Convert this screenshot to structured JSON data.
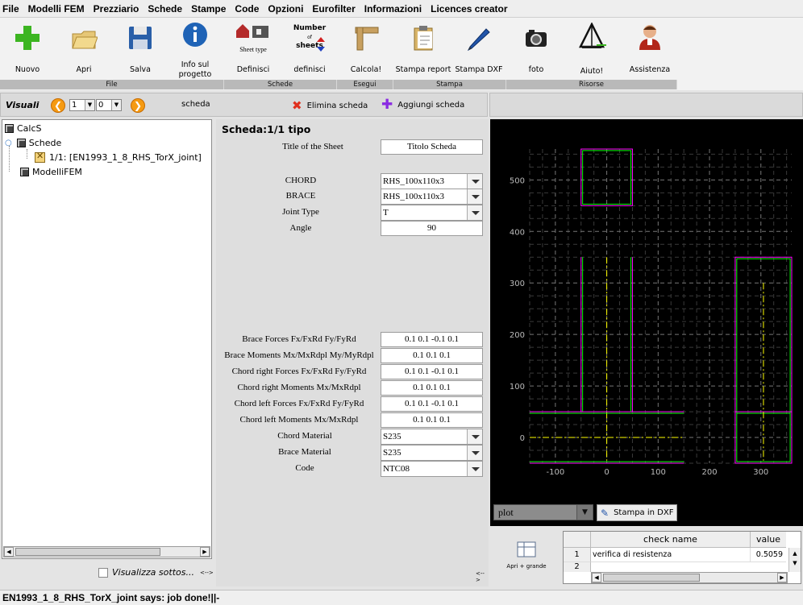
{
  "menu": [
    "File",
    "Modelli FEM",
    "Prezziario",
    "Schede",
    "Stampe",
    "Code",
    "Opzioni",
    "Eurofilter",
    "Informazioni",
    "Licences creator"
  ],
  "ribbon": {
    "tools": {
      "nuovo": "Nuovo",
      "apri": "Apri",
      "salva": "Salva",
      "info1": "Info sul",
      "info2": "progetto",
      "definisci": "Definisci",
      "sheet_type": "Sheet type",
      "number1": "Number",
      "number2": "of",
      "number3": "sheets",
      "definisci2": "definisci",
      "calcola": "Calcola!",
      "stampa_report": "Stampa report",
      "stampa_dxf": "Stampa DXF",
      "foto": "foto",
      "aiuto": "Aiuto!",
      "assistenza": "Assistenza"
    },
    "groups": {
      "file": "File",
      "schede": "Schede",
      "esegui": "Esegui",
      "stampa": "Stampa",
      "risorse": "Risorse"
    }
  },
  "visuali": {
    "title": "Visuali",
    "spin1": "1",
    "spin2": "0",
    "scheda": "scheda",
    "elimina": "Elimina scheda",
    "aggiungi": "Aggiungi scheda"
  },
  "tree": {
    "root": "CalcS",
    "schede": "Schede",
    "item": "1/1: [EN1993_1_8_RHS_TorX_joint]",
    "modelli": "ModelliFEM",
    "visualizza": "Visualizza sottos...",
    "arrows": "<-->"
  },
  "sheet": {
    "title": "Scheda:1/1 tipo",
    "title_label": "Title of the Sheet",
    "title_value": "Titolo Scheda",
    "chord_label": "CHORD",
    "chord_value": "RHS_100x110x3",
    "brace_label": "BRACE",
    "brace_value": "RHS_100x110x3",
    "joint_label": "Joint Type",
    "joint_value": "T",
    "angle_label": "Angle",
    "angle_value": "90",
    "bf_label": "Brace Forces Fx/FxRd Fy/FyRd",
    "bf_value": "0.1 0.1 -0.1 0.1",
    "bm_label": "Brace Moments Mx/MxRdpl My/MyRdpl",
    "bm_value": "0.1 0.1 0.1",
    "crf_label": "Chord right Forces Fx/FxRd Fy/FyRd",
    "crf_value": "0.1 0.1 -0.1 0.1",
    "crm_label": "Chord right Moments Mx/MxRdpl",
    "crm_value": "0.1 0.1 0.1",
    "clf_label": "Chord left Forces Fx/FxRd Fy/FyRd",
    "clf_value": "0.1 0.1 -0.1 0.1",
    "clm_label": "Chord left Moments Mx/MxRdpl",
    "clm_value": "0.1 0.1 0.1",
    "cmat_label": "Chord Material",
    "cmat_value": "S235",
    "bmat_label": "Brace Material",
    "bmat_value": "S235",
    "code_label": "Code",
    "code_value": "NTC08",
    "arrows": "<-->"
  },
  "plot": {
    "select": "plot",
    "stampa_dxf": "Stampa in DXF",
    "yticks": [
      "500",
      "400",
      "300",
      "200",
      "100",
      "0"
    ],
    "xticks": [
      "-100",
      "0",
      "100",
      "200",
      "300"
    ]
  },
  "results": {
    "apri_grande": "Apri + grande",
    "col_check": "check name",
    "col_value": "value",
    "row1_index": "1",
    "row1_name": "verifica di resistenza",
    "row1_value": "0.5059",
    "row2_index": "2"
  },
  "status": "EN1993_1_8_RHS_TorX_joint says: job done!||-",
  "colors": {
    "accent_orange": "#f59a12",
    "plot_bg": "#000000",
    "magenta": "#ff00ff",
    "green": "#00ff00",
    "yellow": "#ffff00"
  }
}
